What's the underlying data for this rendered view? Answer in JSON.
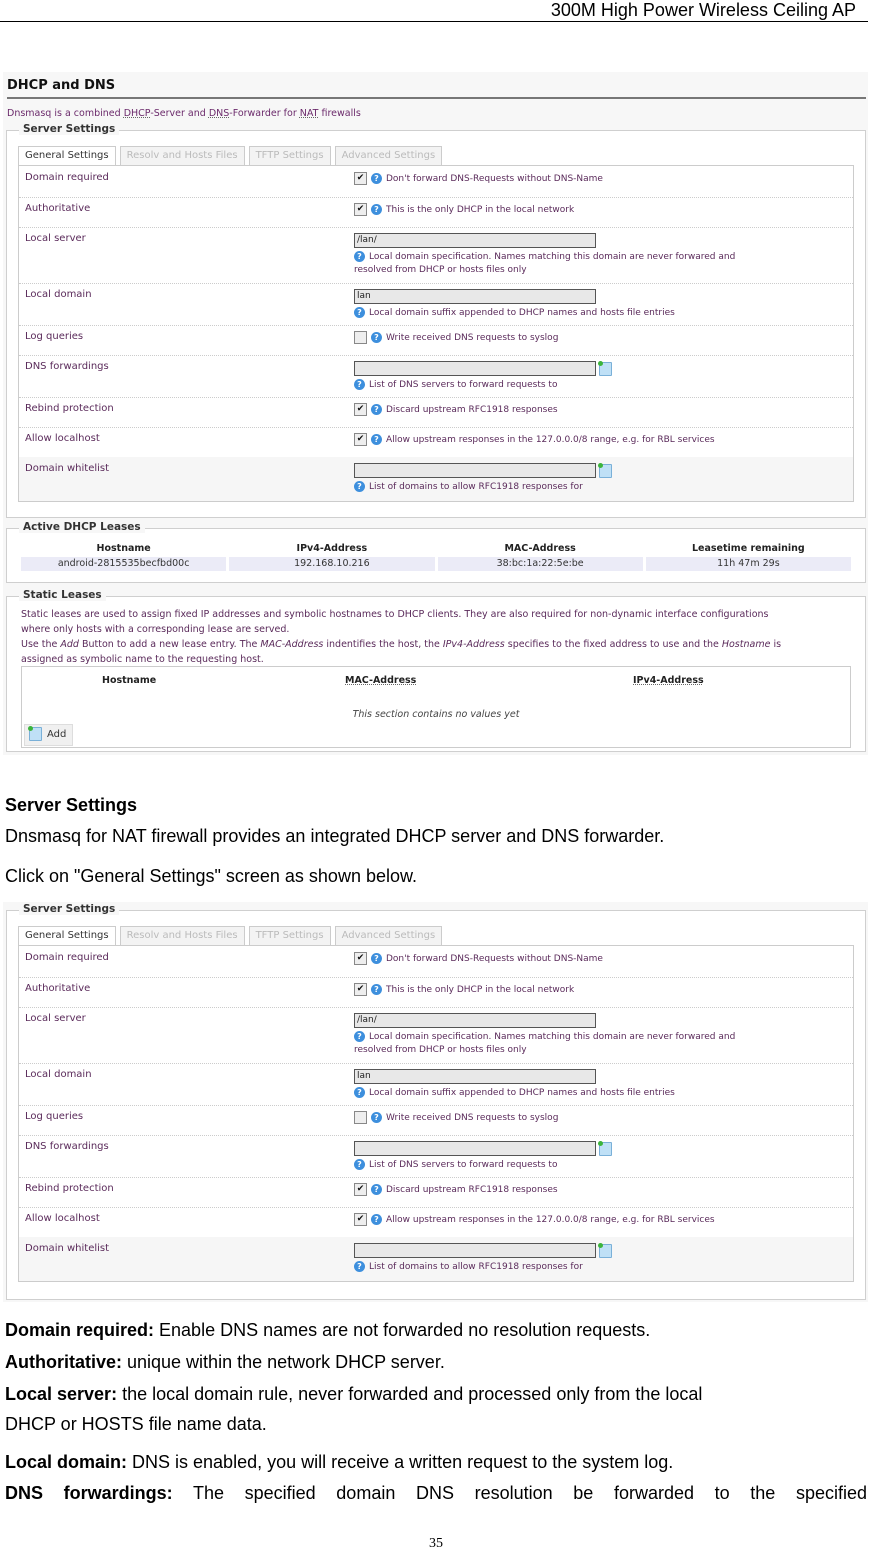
{
  "header": {
    "title": "300M High Power Wireless Ceiling AP"
  },
  "screenshot1": {
    "title": "DHCP and DNS",
    "description": {
      "pre": "Dnsmasq is a combined ",
      "a1": "DHCP",
      "mid1": "-Server and ",
      "a2": "DNS",
      "mid2": "-Forwarder for ",
      "a3": "NAT",
      "post": " firewalls"
    },
    "active_leases": {
      "legend": "Active DHCP Leases",
      "columns": [
        "Hostname",
        "IPv4-Address",
        "MAC-Address",
        "Leasetime remaining"
      ],
      "rows": [
        [
          "android-2815535becfbd00c",
          "192.168.10.216",
          "38:bc:1a:22:5e:be",
          "11h 47m 29s"
        ]
      ]
    },
    "static_leases": {
      "legend": "Static Leases",
      "desc_line1": "Static leases are used to assign fixed IP addresses and symbolic hostnames to DHCP clients. They are also required for non-dynamic interface configurations",
      "desc_line2": "where only hosts with a corresponding lease are served.",
      "desc_line3_a": "Use the ",
      "desc_line3_b": "Add",
      "desc_line3_c": " Button to add a new lease entry. The ",
      "desc_line3_d": "MAC-Address",
      "desc_line3_e": " indentifies the host, the ",
      "desc_line3_f": "IPv4-Address",
      "desc_line3_g": " specifies to the fixed address to use and the ",
      "desc_line3_h": "Hostname",
      "desc_line3_i": " is",
      "desc_line4": "assigned as symbolic name to the requesting host.",
      "columns": [
        "Hostname",
        "MAC-Address",
        "IPv4-Address"
      ],
      "empty_text": "This section contains no values yet",
      "add_label": "Add"
    }
  },
  "server_settings": {
    "legend": "Server Settings",
    "tabs": [
      {
        "label": "General Settings",
        "active": true
      },
      {
        "label": "Resolv and Hosts Files",
        "active": false
      },
      {
        "label": "TFTP Settings",
        "active": false
      },
      {
        "label": "Advanced Settings",
        "active": false
      }
    ],
    "rows": [
      {
        "label": "Domain required",
        "type": "checkbox",
        "checked": true,
        "hint": "Don't forward DNS-Requests without DNS-Name"
      },
      {
        "label": "Authoritative",
        "type": "checkbox",
        "checked": true,
        "hint": "This is the only DHCP in the local network"
      },
      {
        "label": "Local server",
        "type": "text",
        "value": "/lan/",
        "hint": "Local domain specification. Names matching this domain are never forwared and",
        "hint2": "resolved from DHCP or hosts files only"
      },
      {
        "label": "Local domain",
        "type": "text",
        "value": "lan",
        "hint": "Local domain suffix appended to DHCP names and hosts file entries"
      },
      {
        "label": "Log queries",
        "type": "checkbox",
        "checked": false,
        "hint": "Write received DNS requests to syslog"
      },
      {
        "label": "DNS forwardings",
        "type": "dynlist",
        "value": "",
        "hint": "List of DNS servers to forward requests to"
      },
      {
        "label": "Rebind protection",
        "type": "checkbox",
        "checked": true,
        "hint": "Discard upstream RFC1918 responses"
      },
      {
        "label": "Allow localhost",
        "type": "checkbox",
        "checked": true,
        "hint": "Allow upstream responses in the 127.0.0.0/8 range, e.g. for RBL services"
      },
      {
        "label": "Domain whitelist",
        "type": "dynlist",
        "value": "",
        "hint": "List of domains to allow RFC1918 responses for"
      }
    ]
  },
  "doc": {
    "section_heading": "Server Settings",
    "intro": "Dnsmasq for NAT firewall provides an integrated DHCP server and DNS forwarder.",
    "instruction": "Click on \"General Settings\" screen as shown below.",
    "definitions": [
      {
        "term": "Domain required:",
        "text": " Enable DNS names are not forwarded no resolution requests."
      },
      {
        "term": "Authoritative:",
        "text": " unique within the network DHCP server."
      },
      {
        "term": "Local server:",
        "text": " the local domain rule, never forwarded and processed only from the local"
      },
      {
        "term": "",
        "text": "DHCP or HOSTS file name data."
      },
      {
        "term": "Local domain:",
        "text": " DNS is enabled, you will receive a written request to the system log."
      },
      {
        "term": "DNS forwardings:",
        "text": " The specified domain DNS resolution be forwarded to the specified"
      }
    ]
  },
  "footer": {
    "page_number": "35"
  }
}
